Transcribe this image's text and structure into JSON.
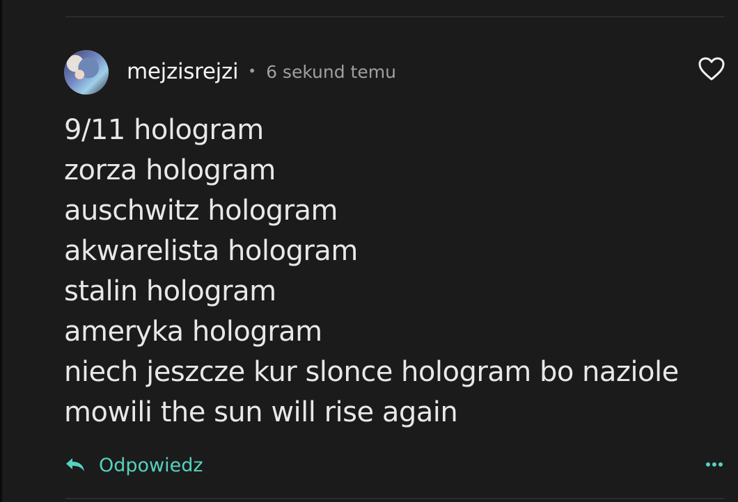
{
  "comment": {
    "username": "mejzisrejzi",
    "separator": "•",
    "timestamp": "6 sekund temu",
    "lines": [
      "9/11 hologram",
      "zorza hologram",
      "auschwitz hologram",
      "akwarelista hologram",
      "stalin hologram",
      "ameryka hologram",
      "niech jeszcze kur slonce hologram bo naziole",
      "mowili the sun will rise again"
    ],
    "reply_label": "Odpowiedz"
  },
  "icons": {
    "like": "heart-icon",
    "reply": "reply-arrow-icon",
    "more": "more-dots-icon"
  },
  "colors": {
    "background": "#1b1b1b",
    "text": "#e8e8e8",
    "muted": "#a0a0a0",
    "accent": "#56d2bf"
  }
}
